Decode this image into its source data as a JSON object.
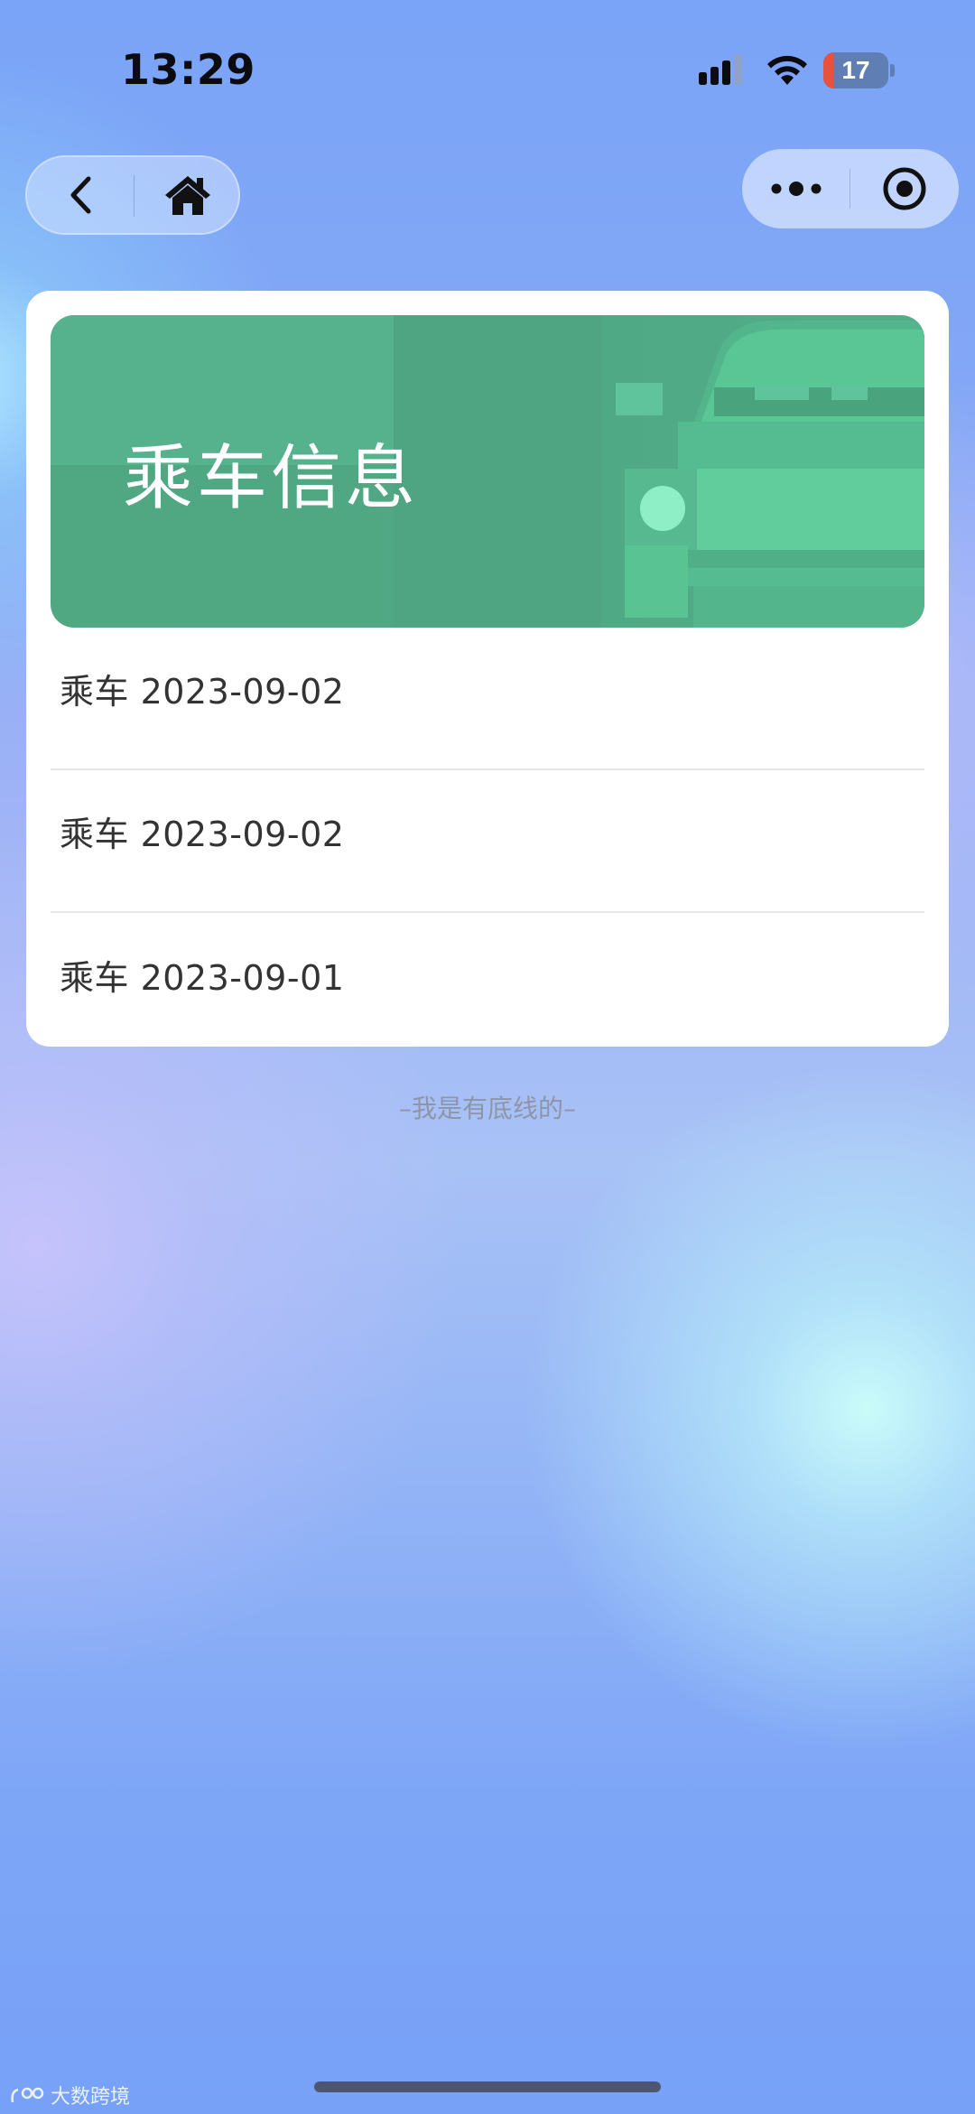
{
  "status_bar": {
    "time": "13:29",
    "battery_level": "17",
    "battery_fraction": 0.17,
    "icons": [
      "signal-icon",
      "wifi-icon",
      "battery-icon"
    ]
  },
  "nav": {
    "icons": [
      "back-icon",
      "home-icon",
      "more-icon",
      "close-miniprogram-icon"
    ]
  },
  "card": {
    "banner_title": "乘车信息",
    "items": [
      {
        "label": "乘车 2023-09-02"
      },
      {
        "label": "乘车 2023-09-02"
      },
      {
        "label": "乘车 2023-09-01"
      }
    ]
  },
  "footer": {
    "bottom_line": "–我是有底线的–",
    "watermark": "大数跨境"
  },
  "colors": {
    "banner_green": "#50a884",
    "text_dark": "#333333",
    "footer_gray": "#8e95a8",
    "battery_red": "#e5533f"
  }
}
